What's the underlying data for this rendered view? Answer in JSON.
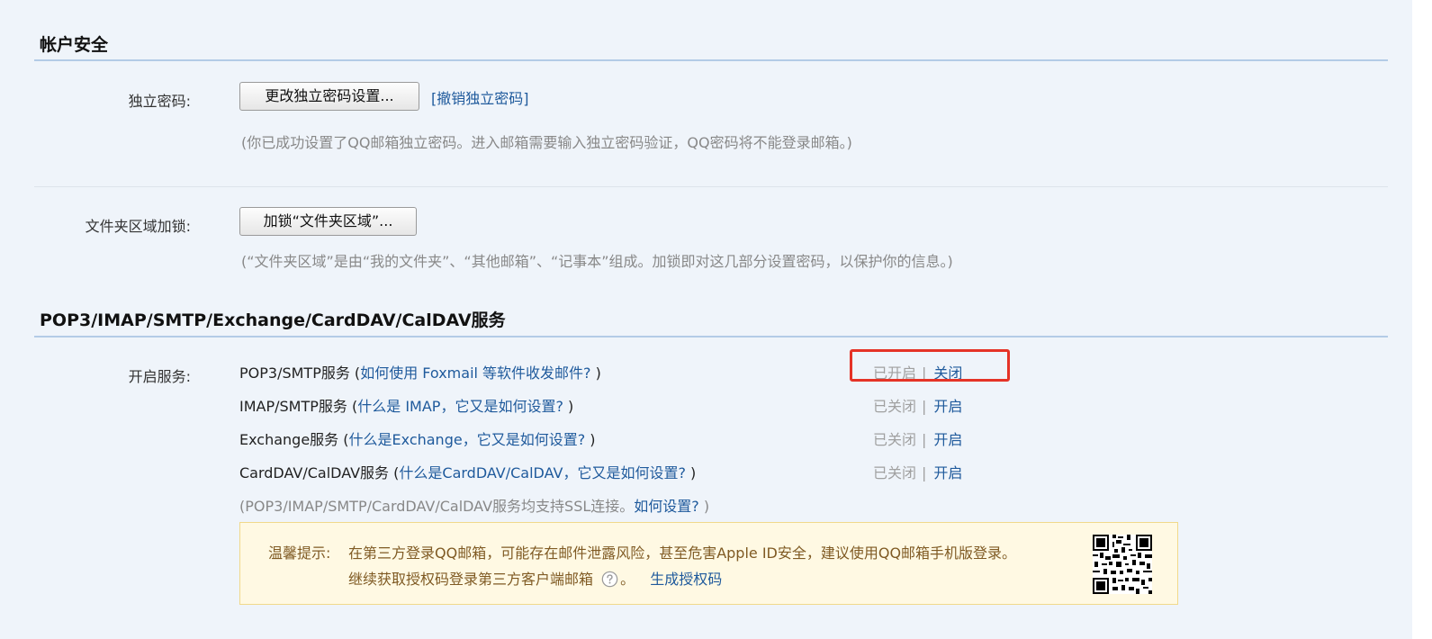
{
  "account_security": {
    "title": "帐户安全",
    "independent_password": {
      "label": "独立密码:",
      "change_button": "更改独立密码设置...",
      "revoke_open": "[",
      "revoke_link": "撤销独立密码",
      "revoke_close": "]",
      "hint": "(你已成功设置了QQ邮箱独立密码。进入邮箱需要输入独立密码验证，QQ密码将不能登录邮箱。)"
    },
    "folder_lock": {
      "label": "文件夹区域加锁:",
      "lock_button": "加锁“文件夹区域”...",
      "hint": "(“文件夹区域”是由“我的文件夹”、“其他邮箱”、“记事本”组成。加锁即对这几部分设置密码，以保护你的信息。)"
    }
  },
  "services": {
    "title": "POP3/IMAP/SMTP/Exchange/CardDAV/CalDAV服务",
    "label": "开启服务:",
    "rows": [
      {
        "name": "POP3/SMTP服务 (",
        "help": "如何使用 Foxmail 等软件收发邮件?",
        "close": " )",
        "state": "已开启",
        "sep": "|",
        "action": "关闭"
      },
      {
        "name": "IMAP/SMTP服务 (",
        "help": "什么是 IMAP，它又是如何设置?",
        "close": " )",
        "state": "已关闭",
        "sep": "|",
        "action": "开启"
      },
      {
        "name": "Exchange服务 (",
        "help": "什么是Exchange，它又是如何设置?",
        "close": " )",
        "state": "已关闭",
        "sep": "|",
        "action": "开启"
      },
      {
        "name": "CardDAV/CalDAV服务 (",
        "help": "什么是CardDAV/CalDAV，它又是如何设置?",
        "close": " )",
        "state": "已关闭",
        "sep": "|",
        "action": "开启"
      }
    ],
    "ssl_note_prefix": "(POP3/IMAP/SMTP/CardDAV/CalDAV服务均支持SSL连接。",
    "ssl_note_link": "如何设置?",
    "ssl_note_suffix": " )",
    "notice": {
      "prefix": "温馨提示:",
      "line1": "在第三方登录QQ邮箱，可能存在邮件泄露风险，甚至危害Apple ID安全，建议使用QQ邮箱手机版登录。",
      "line2_text": "继续获取授权码登录第三方客户端邮箱",
      "line2_sep": "。",
      "generate_link": "生成授权码"
    }
  },
  "colors": {
    "link": "#1f5a9c",
    "highlight": "#e53327",
    "notice_bg": "#fff9e3",
    "notice_text": "#7f5a23"
  }
}
